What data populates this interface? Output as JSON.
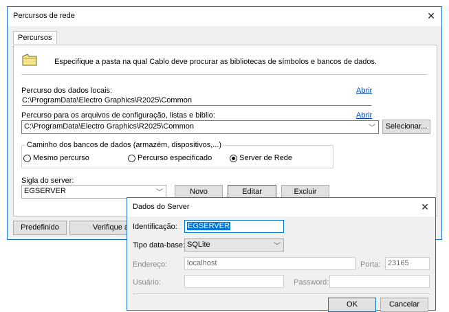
{
  "main_dialog": {
    "title": "Percursos de rede",
    "close": "✕",
    "tab_label": "Percursos",
    "instruction": "Especifique a pasta na qual Cablo deve procurar as bibliotecas de símbolos e bancos de dados.",
    "local_data_label": "Percurso dos dados locais:",
    "local_data_link": "Abrir",
    "local_data_value": "C:\\ProgramData\\Electro Graphics\\R2025\\Common",
    "config_label": "Percurso para os arquivos de configuração, listas e biblio:",
    "config_link": "Abrir",
    "config_value": "C:\\ProgramData\\Electro Graphics\\R2025\\Common",
    "select_button": "Selecionar...",
    "db_group_label": "Caminho dos bancos de dados (armazém, dispositivos,...)",
    "radio_same": "Mesmo percurso",
    "radio_specified": "Percurso especificado",
    "radio_server": "Server de Rede",
    "server_label": "Sigla do server:",
    "server_value": "EGSERVER",
    "new_button": "Novo",
    "edit_button": "Editar",
    "delete_button": "Excluir",
    "default_button": "Predefinido",
    "verify_button": "Verifique a"
  },
  "server_dialog": {
    "title": "Dados do Server",
    "close": "✕",
    "id_label": "Identificação:",
    "id_value": "EGSERVER",
    "dbtype_label": "Tipo data-base:",
    "dbtype_value": "SQLite",
    "address_label": "Endereço:",
    "address_value": "localhost",
    "port_label": "Porta:",
    "port_value": "23165",
    "user_label": "Usuário:",
    "user_value": "",
    "password_label": "Password:",
    "password_value": "",
    "ok_button": "OK",
    "cancel_button": "Cancelar"
  },
  "icons": {
    "folder": "folder-icon",
    "chevron": "chevron-down-icon",
    "close": "close-icon"
  },
  "colors": {
    "accent": "#1a73d6",
    "link": "#0645ad",
    "selection": "#0078d7"
  }
}
